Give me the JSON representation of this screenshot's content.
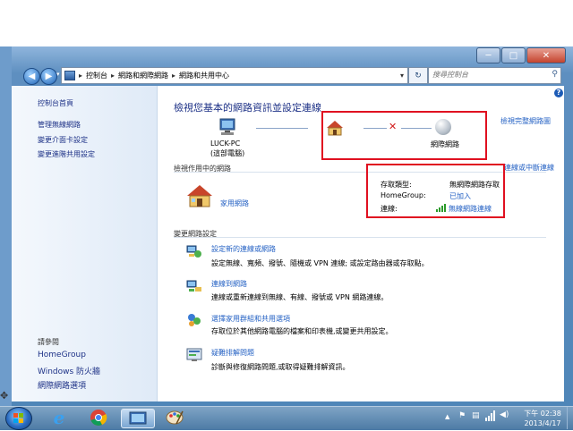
{
  "window": {
    "min_glyph": "─",
    "max_glyph": "□",
    "close_glyph": "✕"
  },
  "address": {
    "crumbs": [
      "控制台",
      "網路和網際網路",
      "網路和共用中心"
    ],
    "separator": "▸",
    "search_placeholder": "搜尋控制台"
  },
  "sidebar": {
    "home": "控制台首頁",
    "items": [
      "管理無線網路",
      "變更介面卡設定",
      "變更進階共用設定"
    ],
    "see_also_title": "請參閱",
    "see_also": [
      "HomeGroup",
      "Windows 防火牆",
      "網際網路選項"
    ]
  },
  "main": {
    "title": "檢視您基本的網路資訊並設定連線",
    "full_map_link": "檢視完整網路圖",
    "computer_name": "LUCK-PC",
    "computer_sub": "(這部電腦)",
    "internet_label": "網際網路",
    "active_networks_title": "檢視作用中的網路",
    "connect_disconnect_link": "連線或中斷連線",
    "network_name": "家用網路",
    "props": {
      "access_type_label": "存取類型:",
      "access_type_value": "無網際網路存取",
      "homegroup_label": "HomeGroup:",
      "homegroup_value": "已加入",
      "connection_label": "連線:",
      "connection_value": "無線網路連線"
    },
    "change_settings_title": "變更網路設定",
    "tasks": [
      {
        "title": "設定新的連線或網路",
        "desc": "設定無線、寬頻、撥號、隨機或 VPN 連線; 或設定路由器或存取點。"
      },
      {
        "title": "連線到網路",
        "desc": "連線或重新連線到無線、有線、撥號或 VPN 網路連線。"
      },
      {
        "title": "選擇家用群組和共用選項",
        "desc": "存取位於其他網路電腦的檔案和印表機,或變更共用設定。"
      },
      {
        "title": "疑難排解問題",
        "desc": "診斷與修復網路問題,或取得疑難排解資訊。"
      }
    ]
  },
  "taskbar": {
    "time": "下午 02:38",
    "date": "2013/4/17"
  },
  "colors": {
    "highlight_box": "#e01020",
    "link": "#2562c4",
    "heading": "#1e3287"
  }
}
